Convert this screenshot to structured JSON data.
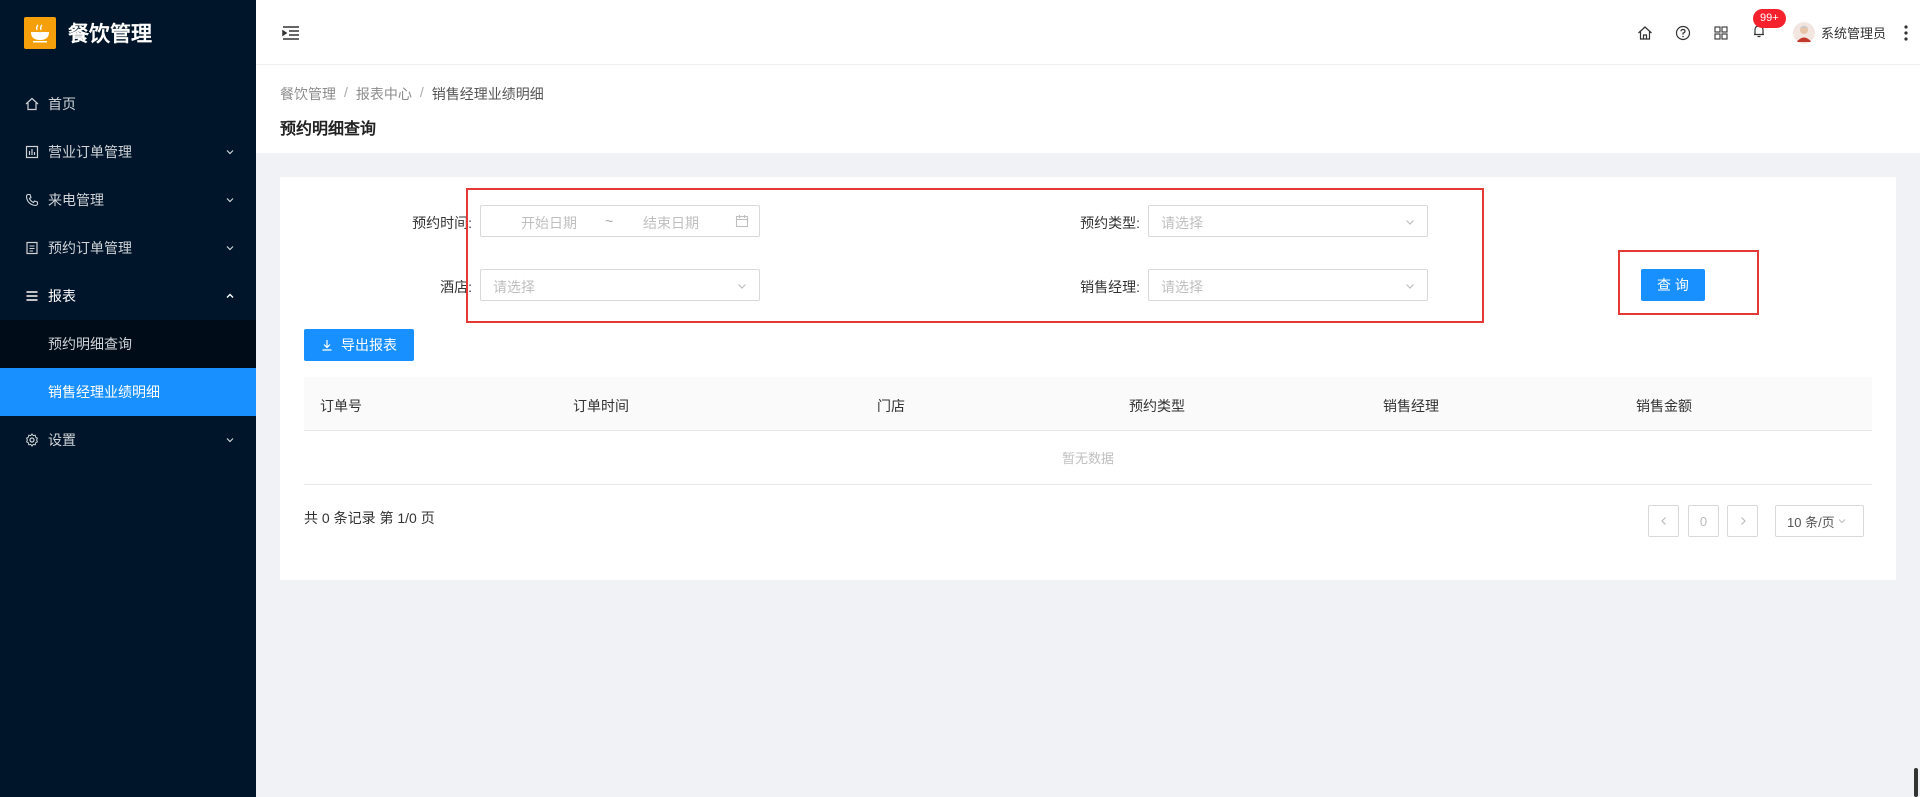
{
  "app": {
    "title": "餐饮管理"
  },
  "sidebar": {
    "items": [
      {
        "label": "首页",
        "icon": "home-icon"
      },
      {
        "label": "营业订单管理",
        "icon": "chart-icon"
      },
      {
        "label": "来电管理",
        "icon": "phone-icon"
      },
      {
        "label": "预约订单管理",
        "icon": "list-icon"
      },
      {
        "label": "报表",
        "icon": "menu-icon"
      },
      {
        "label": "设置",
        "icon": "gear-icon"
      }
    ],
    "report_sub": [
      {
        "label": "预约明细查询"
      },
      {
        "label": "销售经理业绩明细"
      }
    ]
  },
  "header": {
    "badge": "99+",
    "username": "系统管理员"
  },
  "breadcrumb": [
    "餐饮管理",
    "报表中心",
    "销售经理业绩明细"
  ],
  "page_title": "预约明细查询",
  "form": {
    "time_label": "预约时间:",
    "start_placeholder": "开始日期",
    "sep": "~",
    "end_placeholder": "结束日期",
    "type_label": "预约类型:",
    "type_placeholder": "请选择",
    "hotel_label": "酒店:",
    "hotel_placeholder": "请选择",
    "manager_label": "销售经理:",
    "manager_placeholder": "请选择",
    "query_button": "查 询",
    "export_button": "导出报表"
  },
  "table": {
    "columns": [
      "订单号",
      "订单时间",
      "门店",
      "预约类型",
      "销售经理",
      "销售金额"
    ],
    "empty_text": "暂无数据"
  },
  "pagination": {
    "summary": "共 0 条记录 第 1/0 页",
    "current": "0",
    "page_size": "10 条/页"
  },
  "colors": {
    "primary": "#1890ff",
    "sidebar": "#001529",
    "highlight": "#e53935"
  }
}
